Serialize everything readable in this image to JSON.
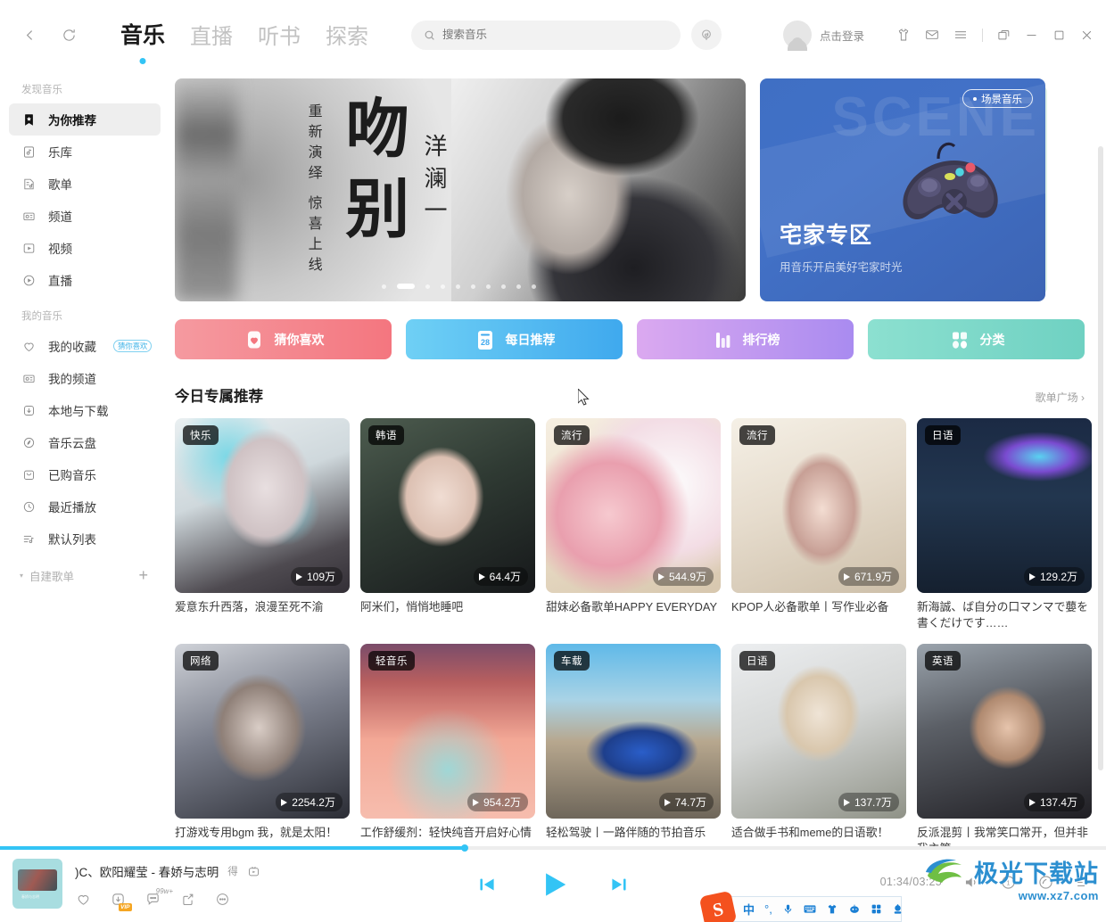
{
  "header": {
    "back_icon": "chevron-left",
    "refresh_icon": "refresh",
    "tabs": [
      {
        "label": "音乐",
        "active": true
      },
      {
        "label": "直播",
        "active": false
      },
      {
        "label": "听书",
        "active": false
      },
      {
        "label": "探索",
        "active": false
      }
    ],
    "search": {
      "placeholder": "搜索音乐",
      "value": ""
    },
    "voice_label": "voice-search",
    "login_text": "点击登录",
    "window_icons": [
      "shirt-icon",
      "mail-icon",
      "menu-icon",
      "mini-window-icon",
      "minimize-icon",
      "maximize-icon",
      "close-icon"
    ]
  },
  "sidebar": {
    "groups": [
      {
        "title": "发现音乐",
        "items": [
          {
            "label": "为你推荐",
            "icon": "bookmark-star-icon",
            "active": true
          },
          {
            "label": "乐库",
            "icon": "music-library-icon",
            "active": false
          },
          {
            "label": "歌单",
            "icon": "playlist-icon",
            "active": false
          },
          {
            "label": "频道",
            "icon": "radio-icon",
            "active": false
          },
          {
            "label": "视频",
            "icon": "video-icon",
            "active": false
          },
          {
            "label": "直播",
            "icon": "live-icon",
            "active": false
          }
        ]
      },
      {
        "title": "我的音乐",
        "items": [
          {
            "label": "我的收藏",
            "icon": "heart-icon",
            "active": false,
            "badge": "猜你喜欢"
          },
          {
            "label": "我的频道",
            "icon": "radio-icon",
            "active": false
          },
          {
            "label": "本地与下载",
            "icon": "download-icon",
            "active": false
          },
          {
            "label": "音乐云盘",
            "icon": "cloud-icon",
            "active": false
          },
          {
            "label": "已购音乐",
            "icon": "purchased-icon",
            "active": false
          },
          {
            "label": "最近播放",
            "icon": "clock-icon",
            "active": false
          },
          {
            "label": "默认列表",
            "icon": "list-music-icon",
            "active": false
          }
        ]
      }
    ],
    "custom_playlist": {
      "label": "自建歌单",
      "add_icon": "plus-icon",
      "caret": "▾"
    }
  },
  "banners": {
    "main": {
      "vertical_text": "重新演绎 惊喜上线",
      "big_title": "吻别",
      "artist": "洋澜一",
      "dots_total": 10,
      "dots_active_index": 1
    },
    "side": {
      "tag": "场景音乐",
      "watermark_text": "SCENE",
      "title": "宅家专区",
      "desc": "用音乐开启美好宅家时光",
      "art": "gamepad-illustration"
    }
  },
  "quick_actions": [
    {
      "label": "猜你喜欢",
      "icon": "heart-card-icon",
      "color_from": "#f59aa0",
      "color_to": "#f4767f"
    },
    {
      "label": "每日推荐",
      "icon": "calendar-28-icon",
      "color_from": "#6fd0f5",
      "color_to": "#3fa9ee",
      "day": "28"
    },
    {
      "label": "排行榜",
      "icon": "bar-chart-icon",
      "color_from": "#dba9f0",
      "color_to": "#a98bf0"
    },
    {
      "label": "分类",
      "icon": "grid-icon",
      "color_from": "#8ce0d0",
      "color_to": "#6fd1c2"
    }
  ],
  "section": {
    "title": "今日专属推荐",
    "more_label": "歌单广场",
    "more_icon": "chevron-right-icon"
  },
  "cards": [
    {
      "tag": "快乐",
      "plays": "109万",
      "title": "爱意东升西落，浪漫至死不渝",
      "art": "t1"
    },
    {
      "tag": "韩语",
      "plays": "64.4万",
      "title": "阿米们，悄悄地睡吧",
      "art": "t2"
    },
    {
      "tag": "流行",
      "plays": "544.9万",
      "title": "甜妹必备歌单HAPPY EVERYDAY",
      "art": "t3"
    },
    {
      "tag": "流行",
      "plays": "671.9万",
      "title": "KPOP人必备歌单丨写作业必备",
      "art": "t4"
    },
    {
      "tag": "日语",
      "plays": "129.2万",
      "title": "新海誠、ば自分の口マンマで蘡を書くだけです……",
      "art": "t5"
    },
    {
      "tag": "网络",
      "plays": "2254.2万",
      "title": "打游戏专用bgm 我，就是太阳！",
      "art": "t6"
    },
    {
      "tag": "轻音乐",
      "plays": "954.2万",
      "title": "工作舒缓剂：轻快纯音开启好心情",
      "art": "t7"
    },
    {
      "tag": "车载",
      "plays": "74.7万",
      "title": "轻松驾驶丨一路伴随的节拍音乐",
      "art": "t8"
    },
    {
      "tag": "日语",
      "plays": "137.7万",
      "title": "适合做手书和meme的日语歌！",
      "art": "t9"
    },
    {
      "tag": "英语",
      "plays": "137.4万",
      "title": "反派混剪丨我常笑口常开，但并非我主管",
      "art": "t10"
    }
  ],
  "player": {
    "song_title": ")C、欧阳耀莹 - 春娇与志明",
    "song_sub": "得",
    "mv_icon": "mv-icon",
    "actions": [
      {
        "name": "favorite",
        "icon": "heart-icon"
      },
      {
        "name": "download",
        "icon": "download-vip-icon",
        "chip": "VIP"
      },
      {
        "name": "comment",
        "icon": "comment-icon",
        "count": "99w+"
      },
      {
        "name": "share",
        "icon": "share-icon"
      },
      {
        "name": "more",
        "icon": "more-icon"
      }
    ],
    "controls": {
      "prev": "previous-icon",
      "play": "play-icon",
      "next": "next-icon"
    },
    "time": "01:34/03:25",
    "volume_icon": "volume-icon",
    "repeat_icon": "repeat-one-icon",
    "lyrics_icon": "lyrics-icon",
    "queue_icon": "playlist-queue-icon",
    "progress_percent": 42,
    "accent_color": "#33c4f5"
  },
  "ime": {
    "logo": "S",
    "mode": "中",
    "icons": [
      "punctuation-icon",
      "microphone-icon",
      "keyboard-icon",
      "skin-icon",
      "toolbox-icon",
      "apps-icon",
      "settings-icon"
    ]
  },
  "watermark": {
    "text": "极光下载站",
    "url": "www.xz7.com"
  }
}
